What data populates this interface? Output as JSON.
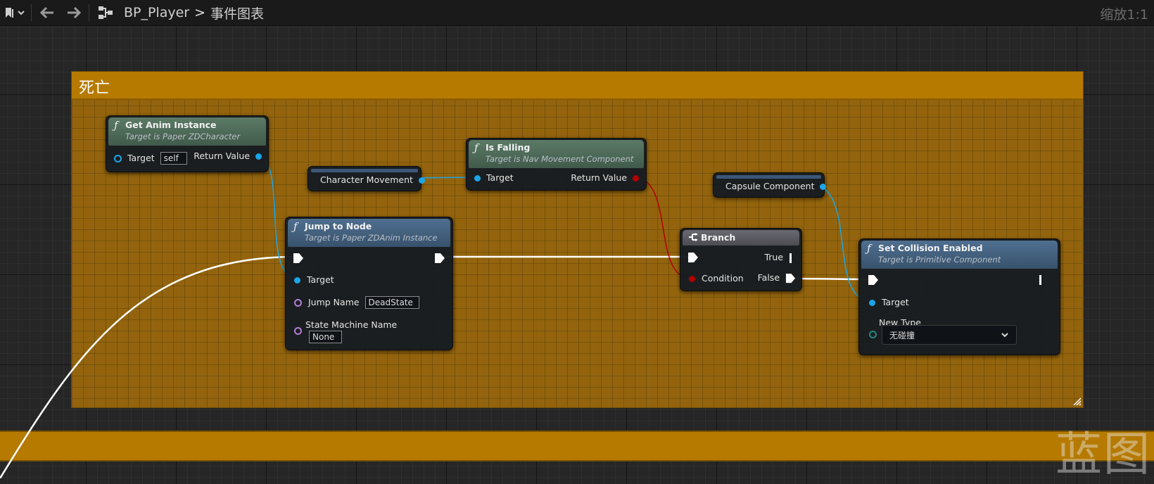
{
  "toolbar": {
    "breadcrumb_asset": "BP_Player",
    "breadcrumb_separator": ">",
    "breadcrumb_graph": "事件图表",
    "zoom": "缩放1:1"
  },
  "comments": {
    "main_title": "死亡"
  },
  "watermark": "蓝图",
  "nodes": {
    "get_anim_instance": {
      "title": "Get Anim Instance",
      "subtitle": "Target is Paper ZDCharacter",
      "target_label": "Target",
      "target_value": "self",
      "return_label": "Return Value"
    },
    "character_movement": {
      "label": "Character Movement"
    },
    "is_falling": {
      "title": "Is Falling",
      "subtitle": "Target is Nav Movement Component",
      "target_label": "Target",
      "return_label": "Return Value"
    },
    "capsule_component": {
      "label": "Capsule Component"
    },
    "jump_to_node": {
      "title": "Jump to Node",
      "subtitle": "Target is Paper ZDAnim Instance",
      "target_label": "Target",
      "jump_name_label": "Jump Name",
      "jump_name_value": "DeadState",
      "state_machine_label": "State Machine Name",
      "state_machine_value": "None"
    },
    "branch": {
      "title": "Branch",
      "condition_label": "Condition",
      "true_label": "True",
      "false_label": "False"
    },
    "set_collision": {
      "title": "Set Collision Enabled",
      "subtitle": "Target is Primitive Component",
      "target_label": "Target",
      "new_type_label": "New Type",
      "new_type_value": "无碰撞"
    }
  },
  "colors": {
    "comment": "#b67a00",
    "exec_wire": "#ffffff",
    "object_pin": "#1aa6e8",
    "bool_pin": "#b30000",
    "name_pin": "#b27fd6",
    "enum_pin": "#1f8a80"
  },
  "icons": [
    "bookmark-icon",
    "chevron-down-icon",
    "back-arrow-icon",
    "forward-arrow-icon",
    "graph-icon",
    "function-icon",
    "branch-icon",
    "resize-icon"
  ]
}
